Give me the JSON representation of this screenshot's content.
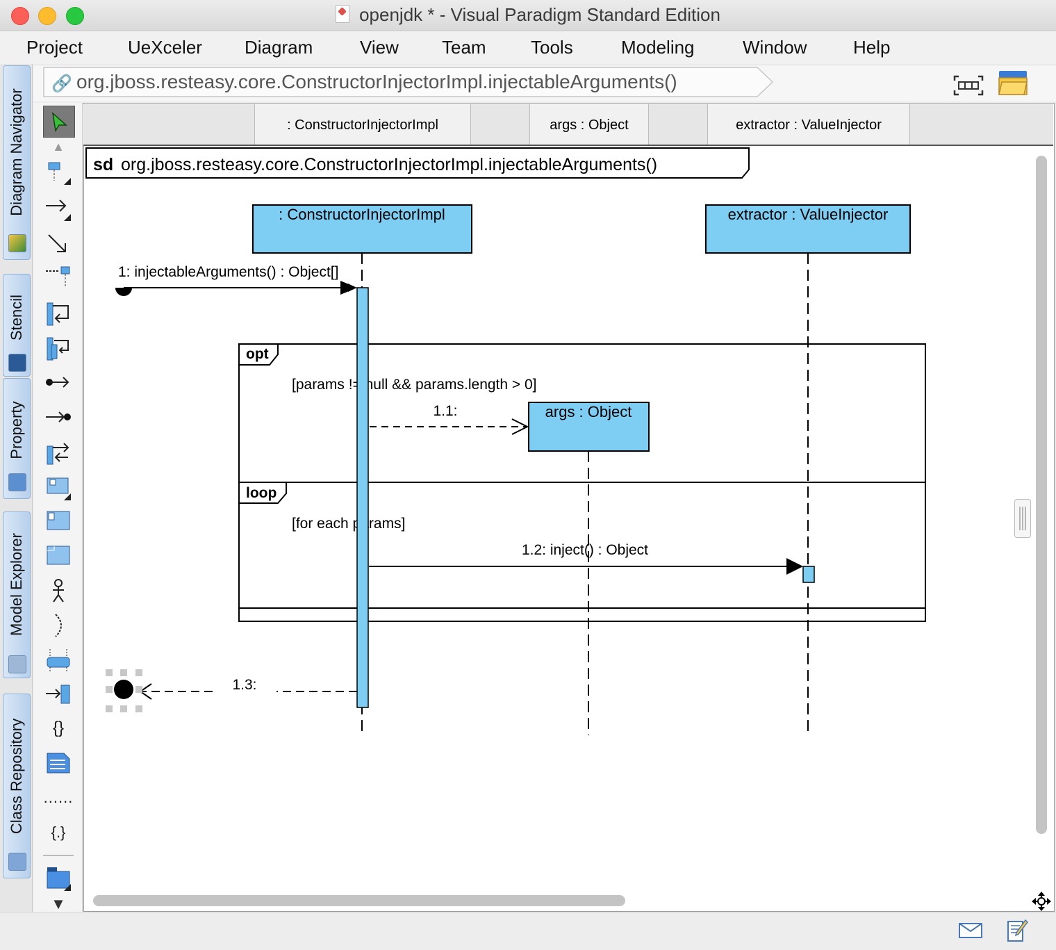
{
  "window": {
    "title": "openjdk * - Visual Paradigm Standard Edition"
  },
  "menu": [
    "Project",
    "UeXceler",
    "Diagram",
    "View",
    "Team",
    "Tools",
    "Modeling",
    "Window",
    "Help"
  ],
  "left_tabs": [
    "Diagram Navigator",
    "Stencil",
    "Property",
    "Model Explorer",
    "Class Repository"
  ],
  "breadcrumb": "org.jboss.resteasy.core.ConstructorInjectorImpl.injectableArguments()",
  "lane_headers": [
    ": ConstructorInjectorImpl",
    "args : Object",
    "extractor : ValueInjector"
  ],
  "diagram": {
    "frame_keyword": "sd",
    "frame_title": "org.jboss.resteasy.core.ConstructorInjectorImpl.injectableArguments()",
    "lifelines": [
      ": ConstructorInjectorImpl",
      "extractor : ValueInjector",
      "args : Object"
    ],
    "messages": [
      "1: injectableArguments() : Object[]",
      "1.1:",
      "1.2: inject() : Object",
      "1.3:"
    ],
    "fragments": [
      {
        "operator": "opt",
        "guard": "[params != null && params.length > 0]"
      },
      {
        "operator": "loop",
        "guard": "[for each params]"
      }
    ]
  },
  "palette_tools": [
    "select-tool",
    "lifeline-tool",
    "message-tool",
    "duration-message-tool",
    "create-message-tool",
    "self-message-tool",
    "recursive-message-tool",
    "found-message-tool",
    "lost-message-tool",
    "reentrant-message-tool",
    "note-activation-tool",
    "frame-tool",
    "interaction-use-tool",
    "actor-tool",
    "boundary-tool",
    "gate-tool",
    "continuation-tool",
    "constraint-tool",
    "comment-tool",
    "anchor-tool",
    "code-tool",
    "package-tool"
  ],
  "colors": {
    "lifeline_fill": "#7ecef4",
    "frame_stroke": "#000000",
    "window_bg": "#ececec"
  }
}
